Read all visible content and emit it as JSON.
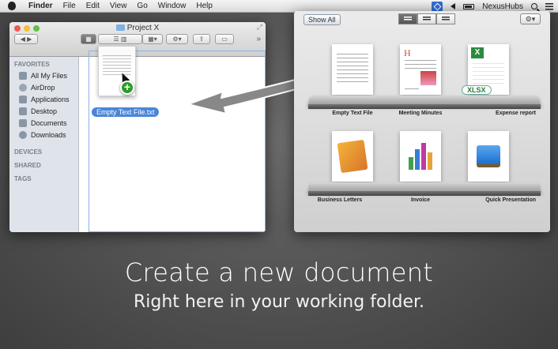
{
  "menubar": {
    "app": "Finder",
    "items": [
      "File",
      "Edit",
      "View",
      "Go",
      "Window",
      "Help"
    ],
    "right_app": "NexusHubs"
  },
  "finder": {
    "title": "Project X",
    "sidebar": {
      "favorites_header": "FAVORITES",
      "items": [
        "All My Files",
        "AirDrop",
        "Applications",
        "Desktop",
        "Documents",
        "Downloads"
      ],
      "devices_header": "DEVICES",
      "shared_header": "SHARED",
      "tags_header": "TAGS"
    },
    "new_file_label": "Empty Text File.txt"
  },
  "templates": {
    "show_all": "Show All",
    "shelf1": [
      "Empty Text File",
      "Meeting Minutes",
      "Expense report"
    ],
    "shelf2": [
      "Business Letters",
      "Invoice",
      "Quick Presentation"
    ],
    "xlsx_badge": "XLSX"
  },
  "headline": "Create a new document",
  "subline": "Right here in your working folder."
}
